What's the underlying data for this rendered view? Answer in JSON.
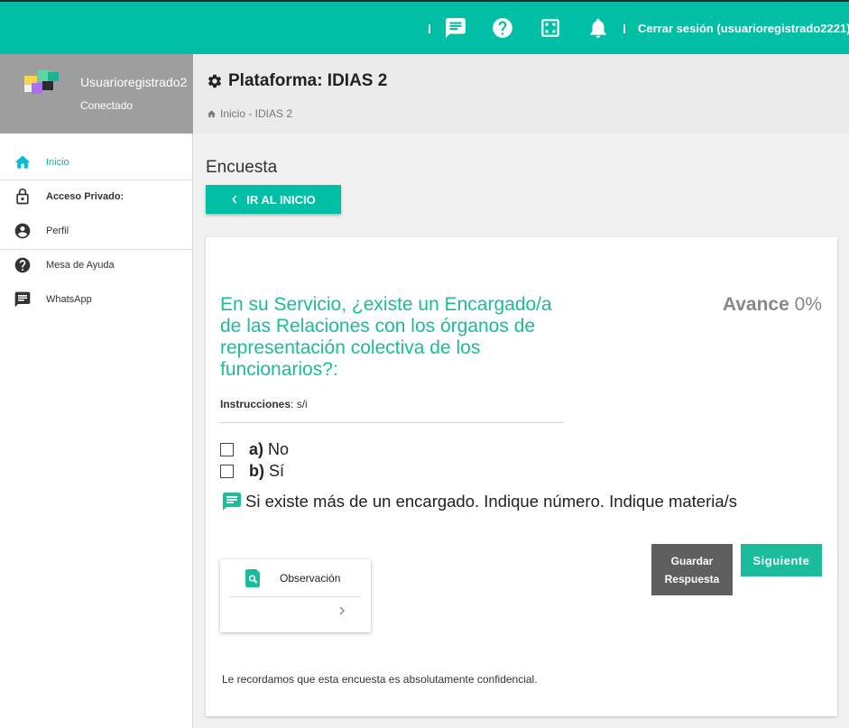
{
  "topbar": {
    "logout_label": "Cerrar sesión (usuarioregistrado2221)",
    "icons": [
      "chat-icon",
      "help-icon",
      "fullscreen-icon",
      "bell-icon"
    ],
    "accent_color": "#00bfa5"
  },
  "sidebar": {
    "user_name": "Usuarioregistrado2",
    "user_status": "Conectado",
    "items": [
      {
        "label": "Inicio",
        "icon": "home-icon",
        "active": true
      },
      {
        "label": "Acceso Privado:",
        "icon": "lock-icon"
      },
      {
        "label": "Perfil",
        "icon": "profile-icon"
      },
      {
        "label": "Mesa de Ayuda",
        "icon": "help-icon"
      },
      {
        "label": "WhatsApp",
        "icon": "chat-icon"
      }
    ]
  },
  "header": {
    "title": "Plataforma: IDIAS 2",
    "breadcrumb": "Inicio - IDIAS 2"
  },
  "main": {
    "section_title": "Encuesta",
    "home_button": "IR AL INICIO",
    "question": "En su Servicio, ¿existe un Encargado/a de las Relaciones con los órganos de representación colectiva de los funcionarios?:",
    "progress_label": "Avance",
    "progress_value": "0%",
    "instructions_label": "Instrucciones",
    "instructions_value": ": s/i",
    "options": [
      {
        "letter": "a)",
        "text": "No",
        "checked": false
      },
      {
        "letter": "b)",
        "text": "Sí",
        "checked": false
      }
    ],
    "comment": "Si existe más de un encargado. Indique número. Indique materia/s",
    "save_button": "Guardar Respuesta",
    "next_button": "Siguiente",
    "observation_label": "Observación",
    "confidential_note": "Le recordamos que esta encuesta es absolutamente confidencial."
  }
}
